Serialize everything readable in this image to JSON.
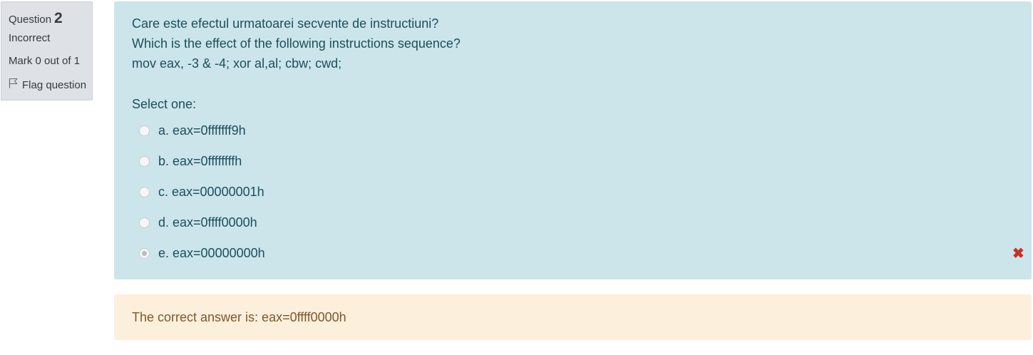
{
  "info": {
    "question_label": "Question",
    "question_number": "2",
    "state": "Incorrect",
    "grade": "Mark 0 out of 1",
    "flag_label": "Flag question"
  },
  "question": {
    "text_lines": [
      "Care este efectul urmatoarei secvente de instructiuni?",
      "Which is the effect of the following instructions sequence?",
      "mov eax, -3 & -4; xor al,al; cbw; cwd;"
    ],
    "prompt": "Select one:",
    "answers": [
      {
        "label": "a. eax=0fffffff9h",
        "selected": false
      },
      {
        "label": "b. eax=0ffffffffh",
        "selected": false
      },
      {
        "label": "c. eax=00000001h",
        "selected": false
      },
      {
        "label": "d. eax=0ffff0000h",
        "selected": false
      },
      {
        "label": "e. eax=00000000h",
        "selected": true,
        "marked_incorrect": true
      }
    ]
  },
  "feedback": {
    "right_answer": "The correct answer is: eax=0ffff0000h"
  },
  "colors": {
    "info_bg": "#dee2e6",
    "formulation_bg": "#cce5ea",
    "formulation_text": "#1b4f5c",
    "outcome_bg": "#fcefdc",
    "outcome_text": "#7d5a29",
    "incorrect_icon": "#ca3120"
  },
  "icons": {
    "flag": "flag-outline-icon",
    "incorrect": "cross-icon"
  }
}
